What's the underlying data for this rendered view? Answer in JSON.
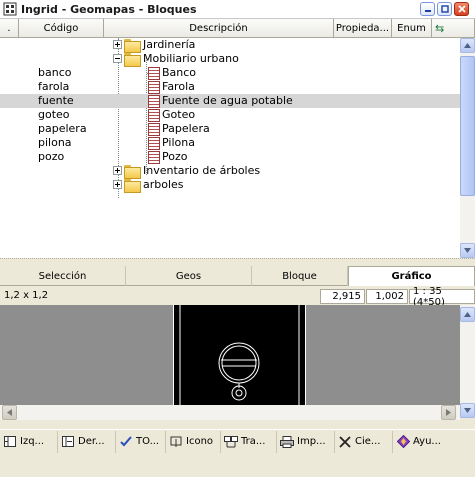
{
  "window": {
    "title": "Ingrid - Geomapas - Bloques"
  },
  "columns": [
    {
      "label": "."
    },
    {
      "label": "Código"
    },
    {
      "label": "Descripción"
    },
    {
      "label": "Propieda..."
    },
    {
      "label": "Enum"
    }
  ],
  "tree": {
    "rows": [
      {
        "code": "",
        "label": "Jardinería",
        "type": "folder",
        "expander": "plus",
        "level": 1
      },
      {
        "code": "",
        "label": "Mobiliario urbano",
        "type": "folder",
        "expander": "minus",
        "level": 1
      },
      {
        "code": "banco",
        "label": "Banco",
        "type": "block",
        "level": 2
      },
      {
        "code": "farola",
        "label": "Farola",
        "type": "block",
        "level": 2
      },
      {
        "code": "fuente",
        "label": "Fuente de agua potable",
        "type": "block",
        "level": 2,
        "selected": true
      },
      {
        "code": "goteo",
        "label": "Goteo",
        "type": "block",
        "level": 2
      },
      {
        "code": "papelera",
        "label": "Papelera",
        "type": "block",
        "level": 2
      },
      {
        "code": "pilona",
        "label": "Pilona",
        "type": "block",
        "level": 2
      },
      {
        "code": "pozo",
        "label": "Pozo",
        "type": "block",
        "level": 2
      },
      {
        "code": "",
        "label": "Inventario de árboles",
        "type": "folder",
        "expander": "plus",
        "level": 1
      },
      {
        "code": "",
        "label": "arboles",
        "type": "folder",
        "expander": "plus",
        "level": 1
      }
    ]
  },
  "tabs": [
    {
      "label": "Selección",
      "active": false
    },
    {
      "label": "Geos",
      "active": false
    },
    {
      "label": "Bloque",
      "active": false
    },
    {
      "label": "Gráfico",
      "active": true
    }
  ],
  "info": {
    "size": "1,2 x 1,2",
    "coord_x": "2,915",
    "coord_y": "1,002",
    "scale": "1 : 35 (4*50)"
  },
  "toolbar": [
    {
      "label": "Izq...",
      "icon": "split-left-icon"
    },
    {
      "label": "Der...",
      "icon": "split-right-icon"
    },
    {
      "label": "TO...",
      "icon": "checkmark-icon"
    },
    {
      "label": "Icono",
      "icon": "icon-bracket-icon"
    },
    {
      "label": "Tra...",
      "icon": "transfer-icon"
    },
    {
      "label": "Imp...",
      "icon": "printer-icon"
    },
    {
      "label": "Cie...",
      "icon": "close-x-icon"
    },
    {
      "label": "Ayu...",
      "icon": "help-diamond-icon"
    }
  ]
}
